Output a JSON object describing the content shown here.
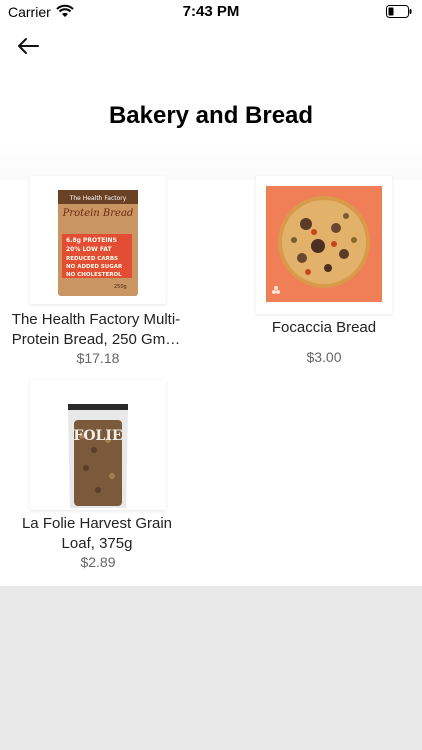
{
  "status_bar": {
    "carrier": "Carrier",
    "time": "7:43 PM"
  },
  "page": {
    "title": "Bakery and Bread"
  },
  "products": [
    {
      "name": "The Health Factory Multi-Protein Bread, 250 Gm…",
      "price": "$17.18",
      "package_brand": "The Health Factory",
      "package_title": "Protein Bread",
      "package_lines": [
        "6.8g PROTEINS",
        "20% LOW FAT",
        "REDUCED CARBS",
        "NO ADDED SUGAR",
        "NO CHOLESTEROL"
      ],
      "package_weight": "250g"
    },
    {
      "name": "Focaccia Bread",
      "price": "$3.00"
    },
    {
      "name": "La Folie Harvest Grain Loaf, 375g",
      "price": "$2.89",
      "package_label": "FOLIE"
    }
  ],
  "colors": {
    "background": "#ffffff",
    "footer_gray": "#e9e9e9",
    "price_gray": "#666666",
    "focaccia_bg": "#f07e56"
  }
}
